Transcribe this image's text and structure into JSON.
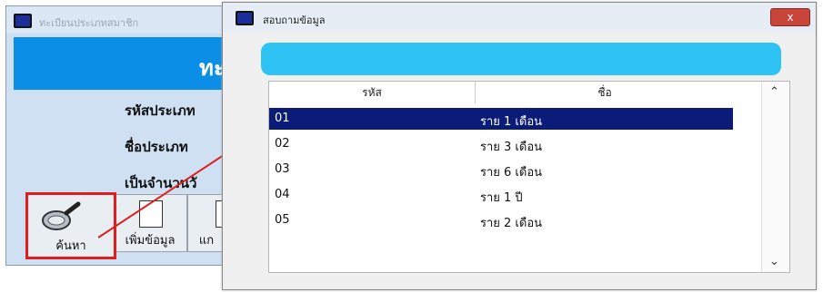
{
  "bg_window": {
    "title": "ทะเบียนประเภทสมาชิก",
    "banner_text": "ทะ",
    "labels": [
      "รหัสประเภท",
      "ชื่อประเภท",
      "เป็นจำนวนวั"
    ],
    "search_label": "ค้นหา",
    "add_label": "เพิ่มข้อมูล",
    "edit_label": "แก"
  },
  "dialog": {
    "title": "สอบถามข้อมูล",
    "close_symbol": "x",
    "columns": [
      "รหัส",
      "ชื่อ"
    ],
    "rows": [
      {
        "code": "01",
        "name": "ราย 1 เดือน"
      },
      {
        "code": "02",
        "name": "ราย 3 เดือน"
      },
      {
        "code": "03",
        "name": "ราย 6 เดือน"
      },
      {
        "code": "04",
        "name": "ราย 1 ปี"
      },
      {
        "code": "05",
        "name": "ราย 2 เดือน"
      }
    ],
    "selected_index": 0
  },
  "colors": {
    "accent_blue": "#0b8fe6",
    "highlight": "#0b1c78",
    "cyan_bar": "#2fc3f5",
    "callout_red": "#e21d1d"
  }
}
